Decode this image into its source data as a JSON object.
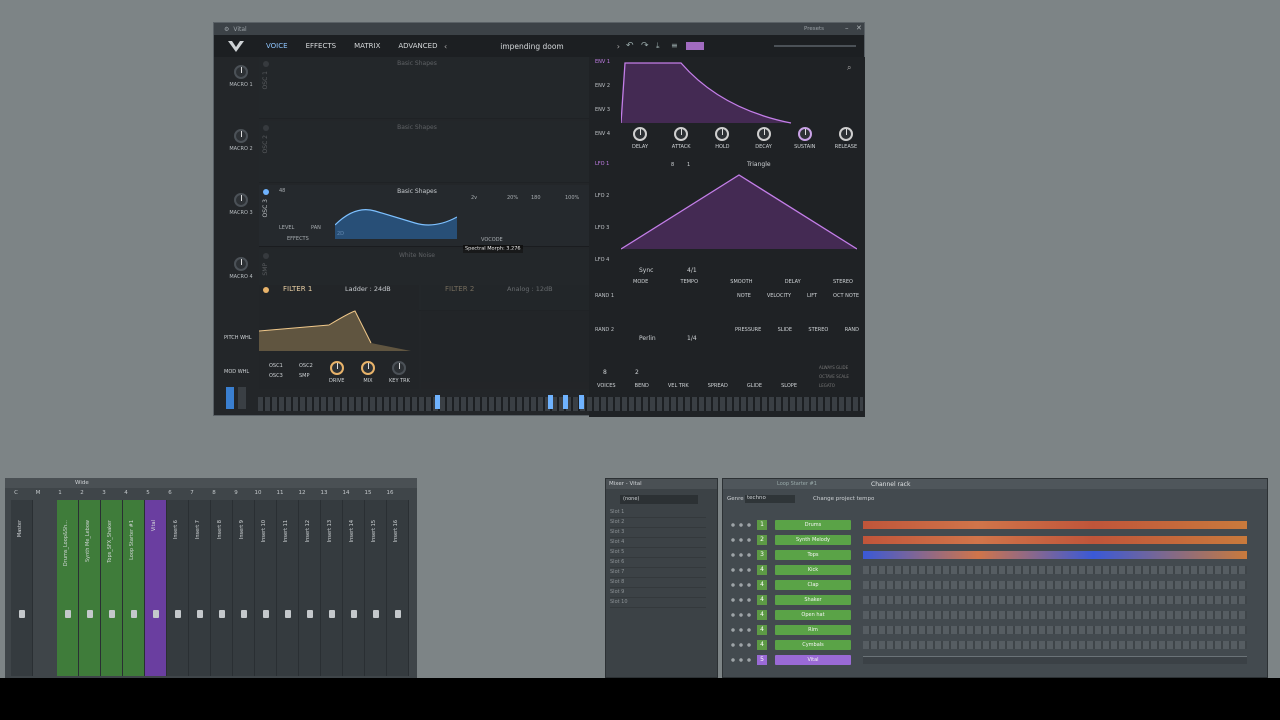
{
  "vital": {
    "title": "Vital",
    "presets_label": "Presets",
    "tabs": [
      {
        "label": "VOICE",
        "active": true
      },
      {
        "label": "EFFECTS",
        "active": false
      },
      {
        "label": "MATRIX",
        "active": false
      },
      {
        "label": "ADVANCED",
        "active": false
      }
    ],
    "preset_name": "impending doom",
    "macros": [
      "MACRO 1",
      "MACRO 2",
      "MACRO 3",
      "MACRO 4"
    ],
    "oscillators": [
      {
        "label": "OSC 1",
        "wave": "Basic Shapes",
        "on": false
      },
      {
        "label": "OSC 2",
        "wave": "Basic Shapes",
        "on": false
      },
      {
        "label": "OSC 3",
        "wave": "Basic Shapes",
        "on": true,
        "pitch": "48",
        "unison": "2v",
        "unison_pct": "20%",
        "phase": "180",
        "phase_pct": "100%",
        "level": "LEVEL",
        "pan": "PAN",
        "effects": "EFFECTS",
        "dim": "2D",
        "tooltip": "Spectral Morph: 3.276",
        "vocode": "VOCODE"
      },
      {
        "label": "SMP",
        "wave": "White Noise",
        "on": false
      }
    ],
    "filter1": {
      "title": "FILTER 1",
      "type": "Ladder : 24dB",
      "osc_labels": [
        "OSC1",
        "OSC2",
        "OSC3",
        "SMP"
      ],
      "knobs": [
        "DRIVE",
        "MIX",
        "KEY TRK"
      ]
    },
    "filter2": {
      "title": "FILTER 2",
      "type": "Analog : 12dB"
    },
    "pitch_wheel": "PITCH WHL",
    "mod_wheel": "MOD WHL",
    "envelopes": [
      "ENV 1",
      "ENV 2",
      "ENV 3",
      "ENV 4"
    ],
    "env_knobs": [
      "DELAY",
      "ATTACK",
      "HOLD",
      "DECAY",
      "SUSTAIN",
      "RELEASE"
    ],
    "lfos": [
      "LFO 1",
      "LFO 2",
      "LFO 3",
      "LFO 4"
    ],
    "lfo_shape": "Triangle",
    "lfo_steps": [
      "8",
      "1"
    ],
    "lfo_mode": "Sync",
    "lfo_tempo": "4/1",
    "lfo_knobs": [
      "MODE",
      "TEMPO",
      "SMOOTH",
      "DELAY",
      "STEREO"
    ],
    "random": [
      "RAND 1",
      "RAND 2"
    ],
    "random_mode": "Perlin",
    "random_tempo": "1/4",
    "mod_sources_row1": [
      "NOTE",
      "VELOCITY",
      "LIFT",
      "OCT NOTE"
    ],
    "mod_sources_row2": [
      "PRESSURE",
      "SLIDE",
      "STEREO",
      "RAND"
    ],
    "voice_section": {
      "voices": "8",
      "bend": "2",
      "labels": [
        "VOICES",
        "BEND",
        "VEL TRK",
        "SPREAD",
        "GLIDE",
        "SLOPE"
      ],
      "options": [
        "ALWAYS GLIDE",
        "OCTAVE SCALE",
        "LEGATO"
      ]
    },
    "colors": {
      "accent_purple": "#c37ee8",
      "accent_blue": "#6fb3ff",
      "filter_gold": "#e8b36a"
    }
  },
  "mixer": {
    "title_hint": "Wide",
    "track_numbers": [
      "C",
      "M",
      "1",
      "2",
      "3",
      "4",
      "5",
      "6",
      "7",
      "8",
      "9",
      "10",
      "11",
      "12",
      "13",
      "14",
      "15",
      "16"
    ],
    "tracks": [
      "Master",
      "Drums_Loop&Sh...",
      "Synth Me_Lebow",
      "Tops_SFX_Shaker",
      "Loop Starter #1",
      "Vital",
      "Insert 6",
      "Insert 7",
      "Insert 8",
      "Insert 9",
      "Insert 10",
      "Insert 11",
      "Insert 12",
      "Insert 13",
      "Insert 14",
      "Insert 15",
      "Insert 16"
    ]
  },
  "insert": {
    "title": "Mixer - Vital",
    "routing": "(none)",
    "slots": [
      "Slot 1",
      "Slot 2",
      "Slot 3",
      "Slot 4",
      "Slot 5",
      "Slot 6",
      "Slot 7",
      "Slot 8",
      "Slot 9",
      "Slot 10"
    ]
  },
  "rack": {
    "title": "Channel rack",
    "pattern": "Loop Starter #1",
    "genre_label": "Genre",
    "genre": "techno",
    "change_tempo": "Change project tempo",
    "channels": [
      {
        "num": "1",
        "name": "Drums",
        "type": "audio"
      },
      {
        "num": "2",
        "name": "Synth Melody",
        "type": "audio"
      },
      {
        "num": "3",
        "name": "Tops",
        "type": "audio"
      },
      {
        "num": "4",
        "name": "Kick",
        "type": "steps"
      },
      {
        "num": "4",
        "name": "Clap",
        "type": "steps"
      },
      {
        "num": "4",
        "name": "Shaker",
        "type": "steps"
      },
      {
        "num": "4",
        "name": "Open hat",
        "type": "steps"
      },
      {
        "num": "4",
        "name": "Rim",
        "type": "steps"
      },
      {
        "num": "4",
        "name": "Cymbals",
        "type": "steps"
      },
      {
        "num": "5",
        "name": "Vital",
        "type": "vital"
      }
    ]
  }
}
